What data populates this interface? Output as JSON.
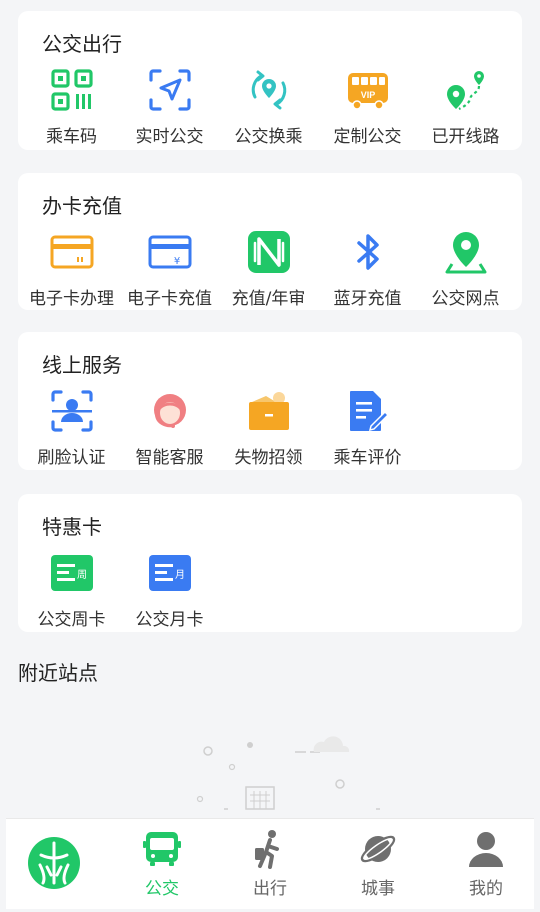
{
  "sections": [
    {
      "title": "公交出行",
      "items": [
        {
          "label": "乘车码",
          "icon": "qr-code-icon"
        },
        {
          "label": "实时公交",
          "icon": "navigation-arrow-icon"
        },
        {
          "label": "公交换乘",
          "icon": "transfer-location-icon"
        },
        {
          "label": "定制公交",
          "icon": "vip-bus-icon"
        },
        {
          "label": "已开线路",
          "icon": "route-pins-icon"
        }
      ]
    },
    {
      "title": "办卡充值",
      "items": [
        {
          "label": "电子卡办理",
          "icon": "card-apply-icon"
        },
        {
          "label": "电子卡充值",
          "icon": "card-recharge-icon"
        },
        {
          "label": "充值/年审",
          "icon": "nfc-icon"
        },
        {
          "label": "蓝牙充值",
          "icon": "bluetooth-icon"
        },
        {
          "label": "公交网点",
          "icon": "map-pin-icon"
        }
      ]
    },
    {
      "title": "线上服务",
      "items": [
        {
          "label": "刷脸认证",
          "icon": "face-scan-icon"
        },
        {
          "label": "智能客服",
          "icon": "customer-service-icon"
        },
        {
          "label": "失物招领",
          "icon": "lost-found-box-icon"
        },
        {
          "label": "乘车评价",
          "icon": "document-edit-icon"
        }
      ]
    },
    {
      "title": "特惠卡",
      "items": [
        {
          "label": "公交周卡",
          "icon": "week-card-icon",
          "badge": "周"
        },
        {
          "label": "公交月卡",
          "icon": "month-card-icon",
          "badge": "月"
        }
      ]
    }
  ],
  "nearby": {
    "title": "附近站点"
  },
  "tabbar": {
    "items": [
      {
        "label": "公交",
        "icon": "bus-icon",
        "active": true
      },
      {
        "label": "出行",
        "icon": "walking-person-icon",
        "active": false
      },
      {
        "label": "城事",
        "icon": "planet-icon",
        "active": false
      },
      {
        "label": "我的",
        "icon": "profile-icon",
        "active": false
      }
    ]
  },
  "colors": {
    "green": "#21c768",
    "blue": "#3a7bf2",
    "orange": "#f5a623",
    "teal": "#33c3c3",
    "pink": "#f07f82",
    "gray": "#8f8f8f"
  }
}
